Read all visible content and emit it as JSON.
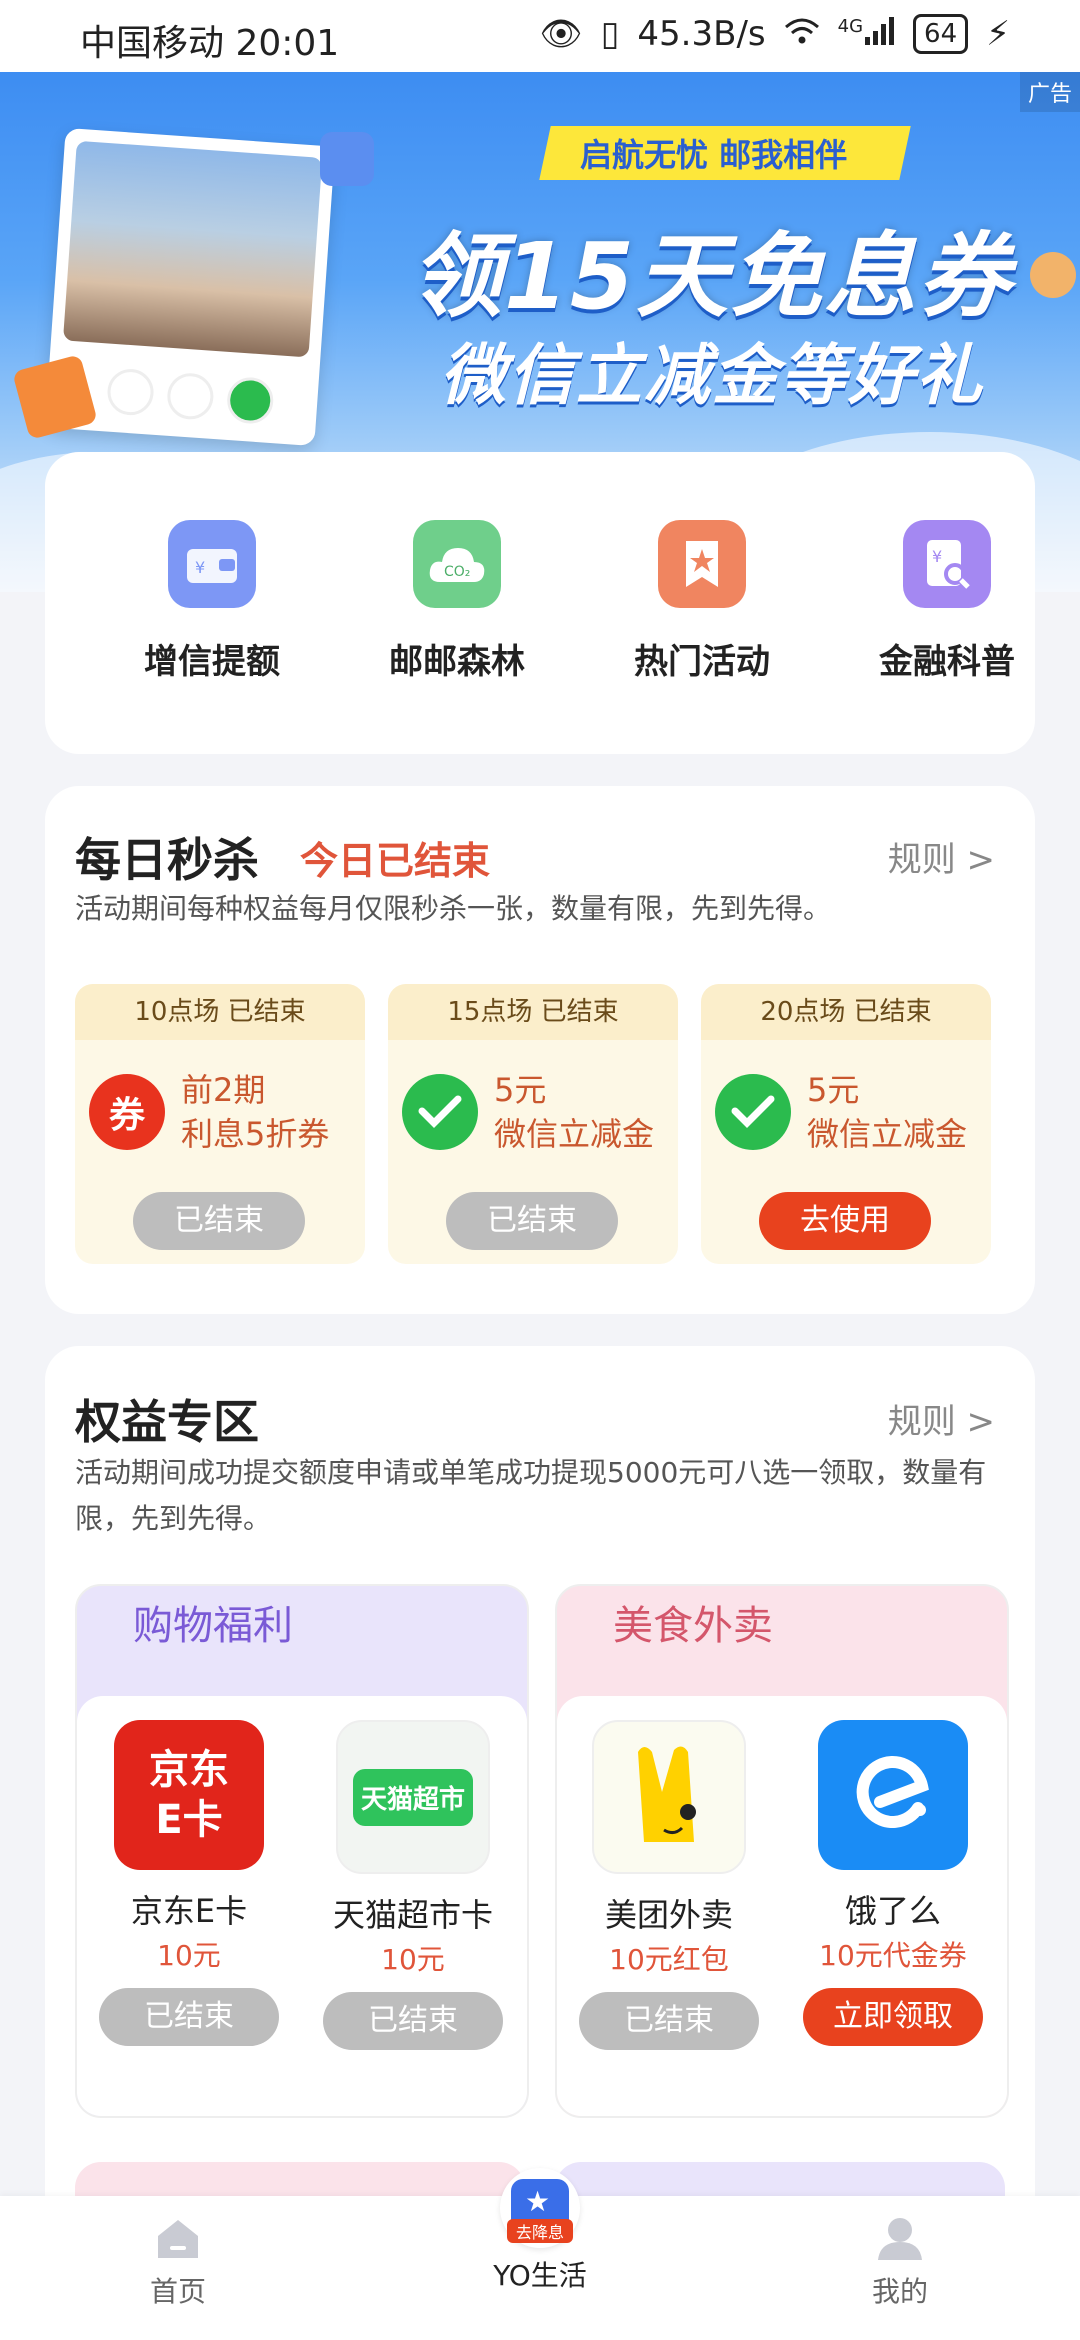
{
  "status_bar": {
    "carrier_time": "中国移动 20:01",
    "net_speed": "45.3B/s",
    "signal": "4G",
    "battery": "64"
  },
  "banner": {
    "ad_label": "广告",
    "slogan": "启航无忧 邮我相伴",
    "headline": "领15天免息券",
    "subheadline": "微信立减金等好礼"
  },
  "quick_actions": [
    {
      "label": "增信提额",
      "icon": "wallet-icon",
      "color": "#6f8ff5"
    },
    {
      "label": "邮邮森林",
      "icon": "co2-cloud-icon",
      "color": "#5fc47e"
    },
    {
      "label": "热门活动",
      "icon": "star-bookmark-icon",
      "color": "#f07a55"
    },
    {
      "label": "金融科普",
      "icon": "finance-search-icon",
      "color": "#9b7cf0"
    }
  ],
  "flash_sale": {
    "title": "每日秒杀",
    "status": "今日已结束",
    "rules": "规则 >",
    "description": "活动期间每种权益每月仅限秒杀一张，数量有限，先到先得。",
    "slots": [
      {
        "time": "10点场 已结束",
        "line1": "前2期",
        "line2": "利息5折券",
        "button": "已结束",
        "icon": "coupon-icon"
      },
      {
        "time": "15点场 已结束",
        "line1": "5元",
        "line2": "微信立减金",
        "button": "已结束",
        "icon": "wechat-pay-icon"
      },
      {
        "time": "20点场 已结束",
        "line1": "5元",
        "line2": "微信立减金",
        "button": "去使用",
        "icon": "wechat-pay-icon"
      }
    ]
  },
  "benefits": {
    "title": "权益专区",
    "rules": "规则 >",
    "description": "活动期间成功提交额度申请或单笔成功提现5000元可八选一领取，数量有限，先到先得。",
    "categories": [
      {
        "name": "购物福利",
        "items": [
          {
            "name": "京东E卡",
            "value": "10元",
            "button": "已结束",
            "logo_text": "京东\nE卡"
          },
          {
            "name": "天猫超市卡",
            "value": "10元",
            "button": "已结束",
            "logo_text": "天猫超市"
          }
        ]
      },
      {
        "name": "美食外卖",
        "items": [
          {
            "name": "美团外卖",
            "value": "10元红包",
            "button": "已结束"
          },
          {
            "name": "饿了么",
            "value": "10元代金券",
            "button": "立即领取"
          }
        ]
      }
    ]
  },
  "bottom_nav": [
    {
      "label": "首页",
      "icon": "home-icon"
    },
    {
      "label": "YO生活",
      "icon": "shopping-bag-icon",
      "badge": "去降息"
    },
    {
      "label": "我的",
      "icon": "profile-icon"
    }
  ]
}
